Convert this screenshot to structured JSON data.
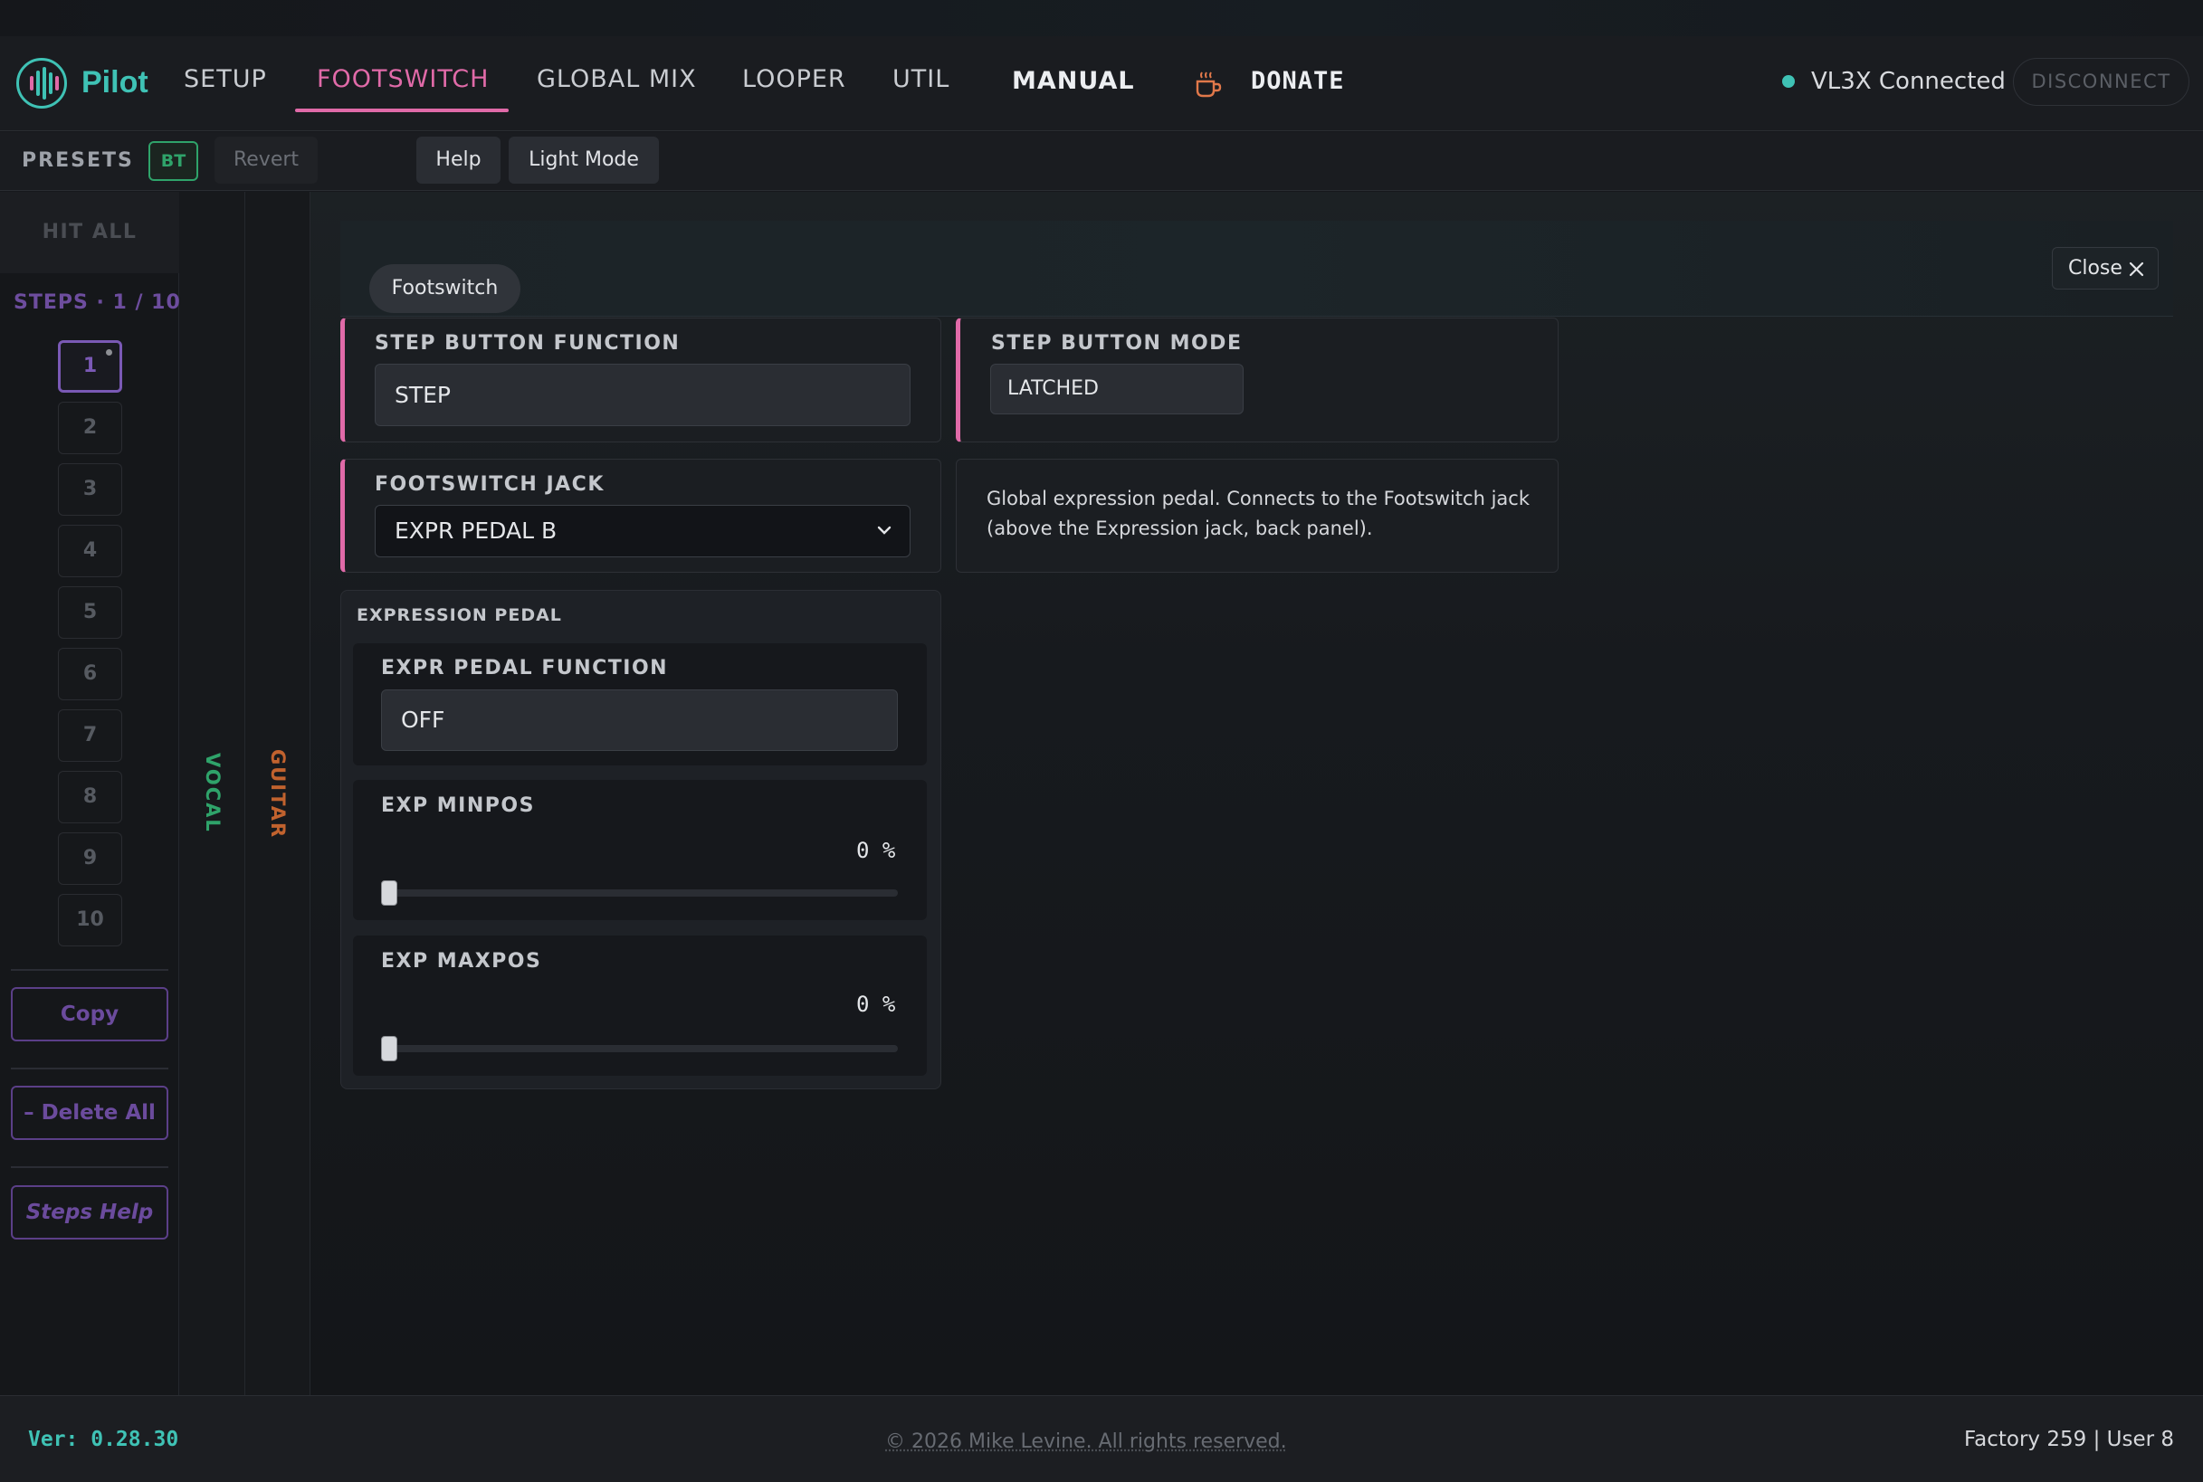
{
  "app": {
    "name": "Pilot",
    "accent_color": "#3fc2b5",
    "highlight_color": "#e06aa8"
  },
  "nav": {
    "tabs": [
      {
        "label": "SETUP"
      },
      {
        "label": "FOOTSWITCH"
      },
      {
        "label": "GLOBAL MIX"
      },
      {
        "label": "LOOPER"
      },
      {
        "label": "UTIL"
      }
    ],
    "active_tab": "FOOTSWITCH",
    "manual_label": "MANUAL",
    "donate_label": "DONATE",
    "donate_icon": "coffee-cup-icon",
    "status_text": "VL3X Connected",
    "status_color": "#3fc2b5",
    "disconnect_label": "DISCONNECT"
  },
  "toolbar": {
    "presets_label": "PRESETS",
    "bt_label": "BT",
    "revert_label": "Revert",
    "help_label": "Help",
    "light_mode_label": "Light Mode"
  },
  "sidebar": {
    "hit_all_label": "HIT ALL",
    "steps_label": "STEPS · 1 / 10",
    "steps": [
      "1",
      "2",
      "3",
      "4",
      "5",
      "6",
      "7",
      "8",
      "9",
      "10"
    ],
    "active_step": "1",
    "copy_label": "Copy",
    "delete_all_label": "– Delete All",
    "steps_help_label": "Steps Help",
    "vocal_label": "VOCAL",
    "guitar_label": "GUITAR"
  },
  "panel": {
    "chip_label": "Footswitch",
    "close_label": "Close",
    "step_button_function": {
      "title": "STEP BUTTON FUNCTION",
      "value": "STEP"
    },
    "step_button_mode": {
      "title": "STEP BUTTON MODE",
      "value": "LATCHED"
    },
    "footswitch_jack": {
      "title": "FOOTSWITCH JACK",
      "value": "EXPR PEDAL B"
    },
    "description": "Global expression pedal. Connects to the Footswitch jack (above the Expression jack, back panel).",
    "expression_pedal": {
      "title": "EXPRESSION PEDAL",
      "function": {
        "title": "EXPR PEDAL FUNCTION",
        "value": "OFF"
      },
      "minpos": {
        "title": "EXP MINPOS",
        "value": "0 %",
        "level": 0
      },
      "maxpos": {
        "title": "EXP MAXPOS",
        "value": "0 %",
        "level": 0
      }
    }
  },
  "footer": {
    "version": "Ver: 0.28.30",
    "copyright": "© 2026 Mike Levine. All rights reserved.",
    "preset_count": "Factory 259 | User 8"
  }
}
